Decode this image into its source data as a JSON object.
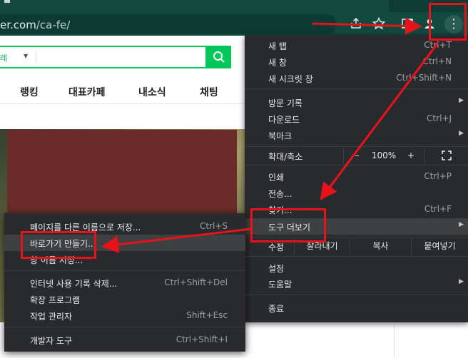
{
  "browser": {
    "url_host": "er.com",
    "url_path": "/ca-fe/",
    "icons": [
      "share-icon",
      "star-icon",
      "side-panel-icon",
      "profile-icon",
      "kebab-menu-icon"
    ]
  },
  "page": {
    "search_scope": "레",
    "nav": [
      "랭킹",
      "대표카페",
      "내소식",
      "채팅"
    ]
  },
  "main_menu": {
    "new_tab": {
      "label": "새 탭",
      "shortcut": "Ctrl+T"
    },
    "new_window": {
      "label": "새 창",
      "shortcut": "Ctrl+N"
    },
    "incognito": {
      "label": "새 시크릿 창",
      "shortcut": "Ctrl+Shift+N"
    },
    "history": {
      "label": "방문 기록"
    },
    "downloads": {
      "label": "다운로드",
      "shortcut": "Ctrl+J"
    },
    "bookmarks": {
      "label": "북마크"
    },
    "zoom": {
      "label": "확대/축소",
      "minus": "–",
      "value": "100%",
      "plus": "+"
    },
    "print": {
      "label": "인쇄",
      "shortcut": "Ctrl+P"
    },
    "cast": {
      "label": "전송..."
    },
    "find": {
      "label": "찾기...",
      "shortcut": "Ctrl+F"
    },
    "more_tools": {
      "label": "도구 더보기"
    },
    "edit": {
      "label": "수정",
      "cut": "잘라내기",
      "copy": "복사",
      "paste": "붙여넣기"
    },
    "settings": {
      "label": "설정"
    },
    "help": {
      "label": "도움말"
    },
    "exit": {
      "label": "종료"
    }
  },
  "sub_menu": {
    "save_as": {
      "label": "페이지를 다른 이름으로 저장...",
      "shortcut": "Ctrl+S"
    },
    "create_shortcut": {
      "label": "바로가기 만들기..."
    },
    "name_window": {
      "label": "창 이름 지정..."
    },
    "clear_data": {
      "label": "인터넷 사용 기록 삭제...",
      "shortcut": "Ctrl+Shift+Del"
    },
    "extensions": {
      "label": "확장 프로그램"
    },
    "task_manager": {
      "label": "작업 관리자",
      "shortcut": "Shift+Esc"
    },
    "devtools": {
      "label": "개발자 도구",
      "shortcut": "Ctrl+Shift+I"
    }
  },
  "colors": {
    "annotation": "#e8121b",
    "menu_bg": "#292a2d",
    "toolbar_bg": "#124a40",
    "naver_green": "#03c75a"
  }
}
